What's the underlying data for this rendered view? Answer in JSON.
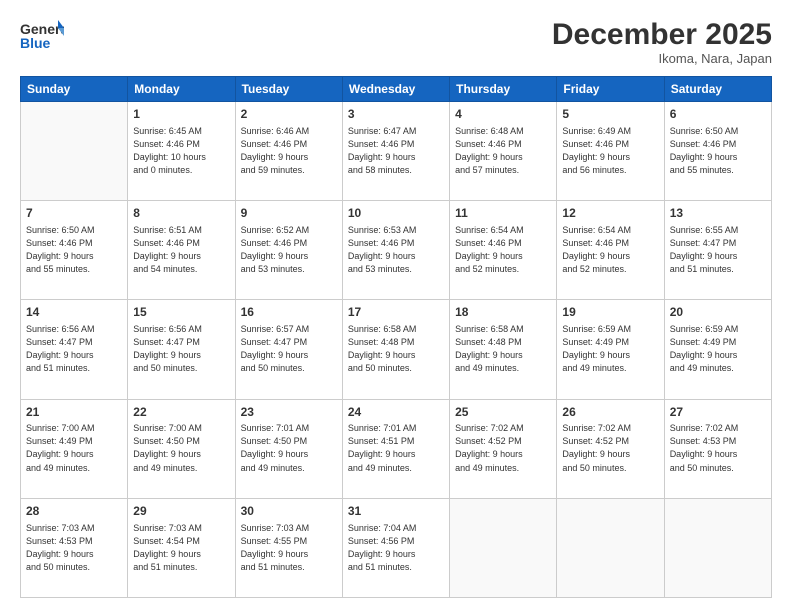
{
  "header": {
    "logo_line1": "General",
    "logo_line2": "Blue",
    "month": "December 2025",
    "location": "Ikoma, Nara, Japan"
  },
  "weekdays": [
    "Sunday",
    "Monday",
    "Tuesday",
    "Wednesday",
    "Thursday",
    "Friday",
    "Saturday"
  ],
  "weeks": [
    [
      {
        "day": "",
        "info": ""
      },
      {
        "day": "1",
        "info": "Sunrise: 6:45 AM\nSunset: 4:46 PM\nDaylight: 10 hours\nand 0 minutes."
      },
      {
        "day": "2",
        "info": "Sunrise: 6:46 AM\nSunset: 4:46 PM\nDaylight: 9 hours\nand 59 minutes."
      },
      {
        "day": "3",
        "info": "Sunrise: 6:47 AM\nSunset: 4:46 PM\nDaylight: 9 hours\nand 58 minutes."
      },
      {
        "day": "4",
        "info": "Sunrise: 6:48 AM\nSunset: 4:46 PM\nDaylight: 9 hours\nand 57 minutes."
      },
      {
        "day": "5",
        "info": "Sunrise: 6:49 AM\nSunset: 4:46 PM\nDaylight: 9 hours\nand 56 minutes."
      },
      {
        "day": "6",
        "info": "Sunrise: 6:50 AM\nSunset: 4:46 PM\nDaylight: 9 hours\nand 55 minutes."
      }
    ],
    [
      {
        "day": "7",
        "info": "Sunrise: 6:50 AM\nSunset: 4:46 PM\nDaylight: 9 hours\nand 55 minutes."
      },
      {
        "day": "8",
        "info": "Sunrise: 6:51 AM\nSunset: 4:46 PM\nDaylight: 9 hours\nand 54 minutes."
      },
      {
        "day": "9",
        "info": "Sunrise: 6:52 AM\nSunset: 4:46 PM\nDaylight: 9 hours\nand 53 minutes."
      },
      {
        "day": "10",
        "info": "Sunrise: 6:53 AM\nSunset: 4:46 PM\nDaylight: 9 hours\nand 53 minutes."
      },
      {
        "day": "11",
        "info": "Sunrise: 6:54 AM\nSunset: 4:46 PM\nDaylight: 9 hours\nand 52 minutes."
      },
      {
        "day": "12",
        "info": "Sunrise: 6:54 AM\nSunset: 4:46 PM\nDaylight: 9 hours\nand 52 minutes."
      },
      {
        "day": "13",
        "info": "Sunrise: 6:55 AM\nSunset: 4:47 PM\nDaylight: 9 hours\nand 51 minutes."
      }
    ],
    [
      {
        "day": "14",
        "info": "Sunrise: 6:56 AM\nSunset: 4:47 PM\nDaylight: 9 hours\nand 51 minutes."
      },
      {
        "day": "15",
        "info": "Sunrise: 6:56 AM\nSunset: 4:47 PM\nDaylight: 9 hours\nand 50 minutes."
      },
      {
        "day": "16",
        "info": "Sunrise: 6:57 AM\nSunset: 4:47 PM\nDaylight: 9 hours\nand 50 minutes."
      },
      {
        "day": "17",
        "info": "Sunrise: 6:58 AM\nSunset: 4:48 PM\nDaylight: 9 hours\nand 50 minutes."
      },
      {
        "day": "18",
        "info": "Sunrise: 6:58 AM\nSunset: 4:48 PM\nDaylight: 9 hours\nand 49 minutes."
      },
      {
        "day": "19",
        "info": "Sunrise: 6:59 AM\nSunset: 4:49 PM\nDaylight: 9 hours\nand 49 minutes."
      },
      {
        "day": "20",
        "info": "Sunrise: 6:59 AM\nSunset: 4:49 PM\nDaylight: 9 hours\nand 49 minutes."
      }
    ],
    [
      {
        "day": "21",
        "info": "Sunrise: 7:00 AM\nSunset: 4:49 PM\nDaylight: 9 hours\nand 49 minutes."
      },
      {
        "day": "22",
        "info": "Sunrise: 7:00 AM\nSunset: 4:50 PM\nDaylight: 9 hours\nand 49 minutes."
      },
      {
        "day": "23",
        "info": "Sunrise: 7:01 AM\nSunset: 4:50 PM\nDaylight: 9 hours\nand 49 minutes."
      },
      {
        "day": "24",
        "info": "Sunrise: 7:01 AM\nSunset: 4:51 PM\nDaylight: 9 hours\nand 49 minutes."
      },
      {
        "day": "25",
        "info": "Sunrise: 7:02 AM\nSunset: 4:52 PM\nDaylight: 9 hours\nand 49 minutes."
      },
      {
        "day": "26",
        "info": "Sunrise: 7:02 AM\nSunset: 4:52 PM\nDaylight: 9 hours\nand 50 minutes."
      },
      {
        "day": "27",
        "info": "Sunrise: 7:02 AM\nSunset: 4:53 PM\nDaylight: 9 hours\nand 50 minutes."
      }
    ],
    [
      {
        "day": "28",
        "info": "Sunrise: 7:03 AM\nSunset: 4:53 PM\nDaylight: 9 hours\nand 50 minutes."
      },
      {
        "day": "29",
        "info": "Sunrise: 7:03 AM\nSunset: 4:54 PM\nDaylight: 9 hours\nand 51 minutes."
      },
      {
        "day": "30",
        "info": "Sunrise: 7:03 AM\nSunset: 4:55 PM\nDaylight: 9 hours\nand 51 minutes."
      },
      {
        "day": "31",
        "info": "Sunrise: 7:04 AM\nSunset: 4:56 PM\nDaylight: 9 hours\nand 51 minutes."
      },
      {
        "day": "",
        "info": ""
      },
      {
        "day": "",
        "info": ""
      },
      {
        "day": "",
        "info": ""
      }
    ]
  ]
}
